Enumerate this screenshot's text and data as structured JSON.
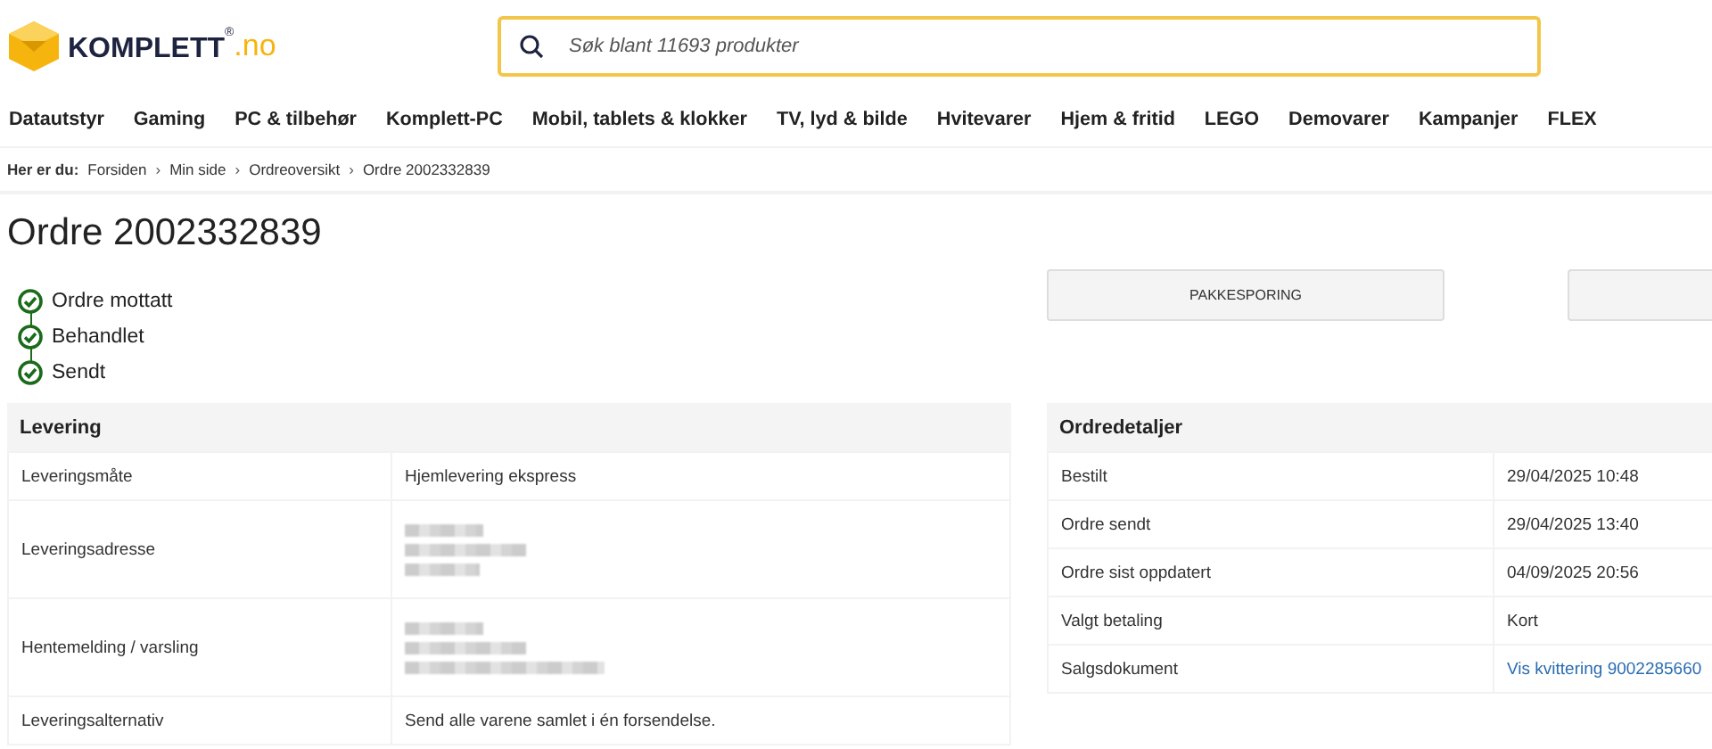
{
  "logo": {
    "name": "KOMPLETT",
    "mark": "®",
    "domain": ".no"
  },
  "search": {
    "placeholder": "Søk blant 11693 produkter"
  },
  "nav": [
    "Datautstyr",
    "Gaming",
    "PC & tilbehør",
    "Komplett-PC",
    "Mobil, tablets & klokker",
    "TV, lyd & bilde",
    "Hvitevarer",
    "Hjem & fritid",
    "LEGO",
    "Demovarer",
    "Kampanjer",
    "FLEX"
  ],
  "breadcrumb": {
    "label": "Her er du:",
    "separator": "›",
    "items": [
      "Forsiden",
      "Min side",
      "Ordreoversikt",
      "Ordre 2002332839"
    ]
  },
  "title": "Ordre 2002332839",
  "status_steps": [
    {
      "label": "Ordre mottatt",
      "done": true
    },
    {
      "label": "Behandlet",
      "done": true
    },
    {
      "label": "Sendt",
      "done": true
    }
  ],
  "buttons": [
    {
      "label": "PAKKESPORING",
      "cut_off": false
    },
    {
      "cut_off": true
    }
  ],
  "delivery": {
    "title": "Levering",
    "rows": [
      {
        "label": "Leveringsmåte",
        "kind": "text",
        "value": "Hjemlevering ekspress"
      },
      {
        "label": "Leveringsadresse",
        "kind": "redacted"
      },
      {
        "label": "Hentemelding / varsling",
        "kind": "redacted"
      },
      {
        "label": "Leveringsalternativ",
        "kind": "text",
        "value": "Send alle varene samlet i én forsendelse."
      }
    ]
  },
  "order_details": {
    "title": "Ordredetaljer",
    "rows": [
      {
        "label": "Bestilt",
        "kind": "text",
        "value": "29/04/2025 10:48"
      },
      {
        "label": "Ordre sendt",
        "kind": "text",
        "value": "29/04/2025 13:40"
      },
      {
        "label": "Ordre sist oppdatert",
        "kind": "text",
        "value": "04/09/2025 20:56"
      },
      {
        "label": "Valgt betaling",
        "kind": "text",
        "value": "Kort"
      },
      {
        "label": "Salgsdokument",
        "kind": "link",
        "value": "Vis kvittering 9002285660"
      }
    ]
  }
}
